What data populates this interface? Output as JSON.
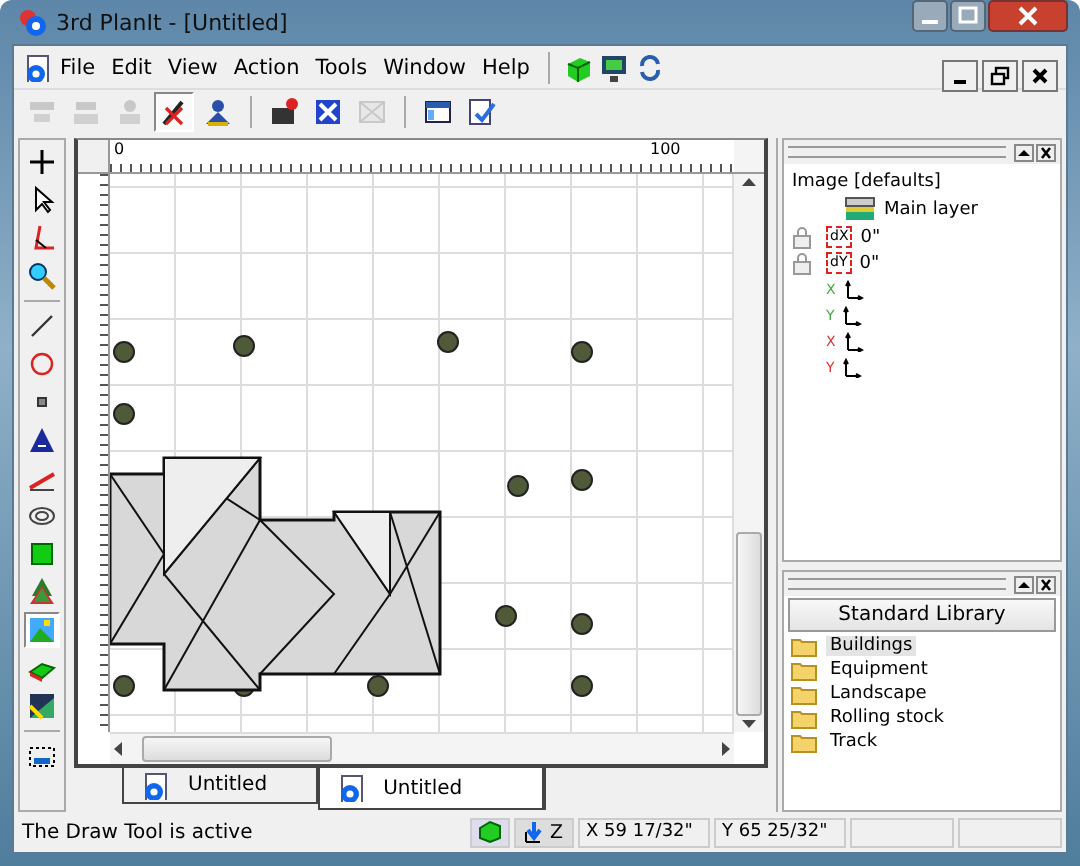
{
  "window": {
    "title": "3rd PlanIt - [Untitled]"
  },
  "menu": [
    "File",
    "Edit",
    "View",
    "Action",
    "Tools",
    "Window",
    "Help"
  ],
  "toolbar": [
    {
      "disabled": true,
      "selected": false
    },
    {
      "disabled": true,
      "selected": false
    },
    {
      "disabled": true,
      "selected": false
    },
    {
      "disabled": false,
      "selected": true
    },
    {
      "disabled": false,
      "selected": false
    },
    {
      "disabled": false,
      "selected": false
    },
    {
      "disabled": false,
      "selected": false
    },
    {
      "disabled": true,
      "selected": false
    },
    {
      "disabled": false,
      "selected": false
    },
    {
      "disabled": false,
      "selected": false
    }
  ],
  "toolbox": [
    {
      "selected": false
    },
    {
      "selected": false
    },
    {
      "selected": false
    },
    {
      "selected": false
    },
    {
      "selected": false
    },
    {
      "selected": false
    },
    {
      "selected": false
    },
    {
      "selected": false
    },
    {
      "selected": false
    },
    {
      "selected": false
    },
    {
      "selected": false
    },
    {
      "selected": false
    },
    {
      "selected": true
    },
    {
      "selected": false
    },
    {
      "selected": false
    },
    {
      "selected": false
    }
  ],
  "ruler": {
    "labels": [
      "0",
      "100"
    ]
  },
  "doc_tabs": [
    {
      "label": "Untitled",
      "selected": false
    },
    {
      "label": "Untitled",
      "selected": true
    }
  ],
  "properties": {
    "title": "Image [defaults]",
    "layer": "Main layer",
    "offsets": [
      {
        "icon_label": "dX",
        "value": "0\""
      },
      {
        "icon_label": "dY",
        "value": "0\""
      }
    ],
    "axes": [
      {
        "label": "X",
        "color": "#44aa44"
      },
      {
        "label": "Y",
        "color": "#44aa44"
      },
      {
        "label": "X",
        "color": "#dd3333"
      },
      {
        "label": "Y",
        "color": "#dd3333"
      }
    ]
  },
  "library": {
    "button": "Standard Library",
    "items": [
      {
        "label": "Buildings",
        "selected": true
      },
      {
        "label": "Equipment",
        "selected": false
      },
      {
        "label": "Landscape",
        "selected": false
      },
      {
        "label": "Rolling stock",
        "selected": false
      },
      {
        "label": "Track",
        "selected": false
      }
    ]
  },
  "status_bar": {
    "message": "The Draw Tool is active",
    "z_label": "Z",
    "x": "X 59 17/32\"",
    "y": "Y 65 25/32\""
  }
}
